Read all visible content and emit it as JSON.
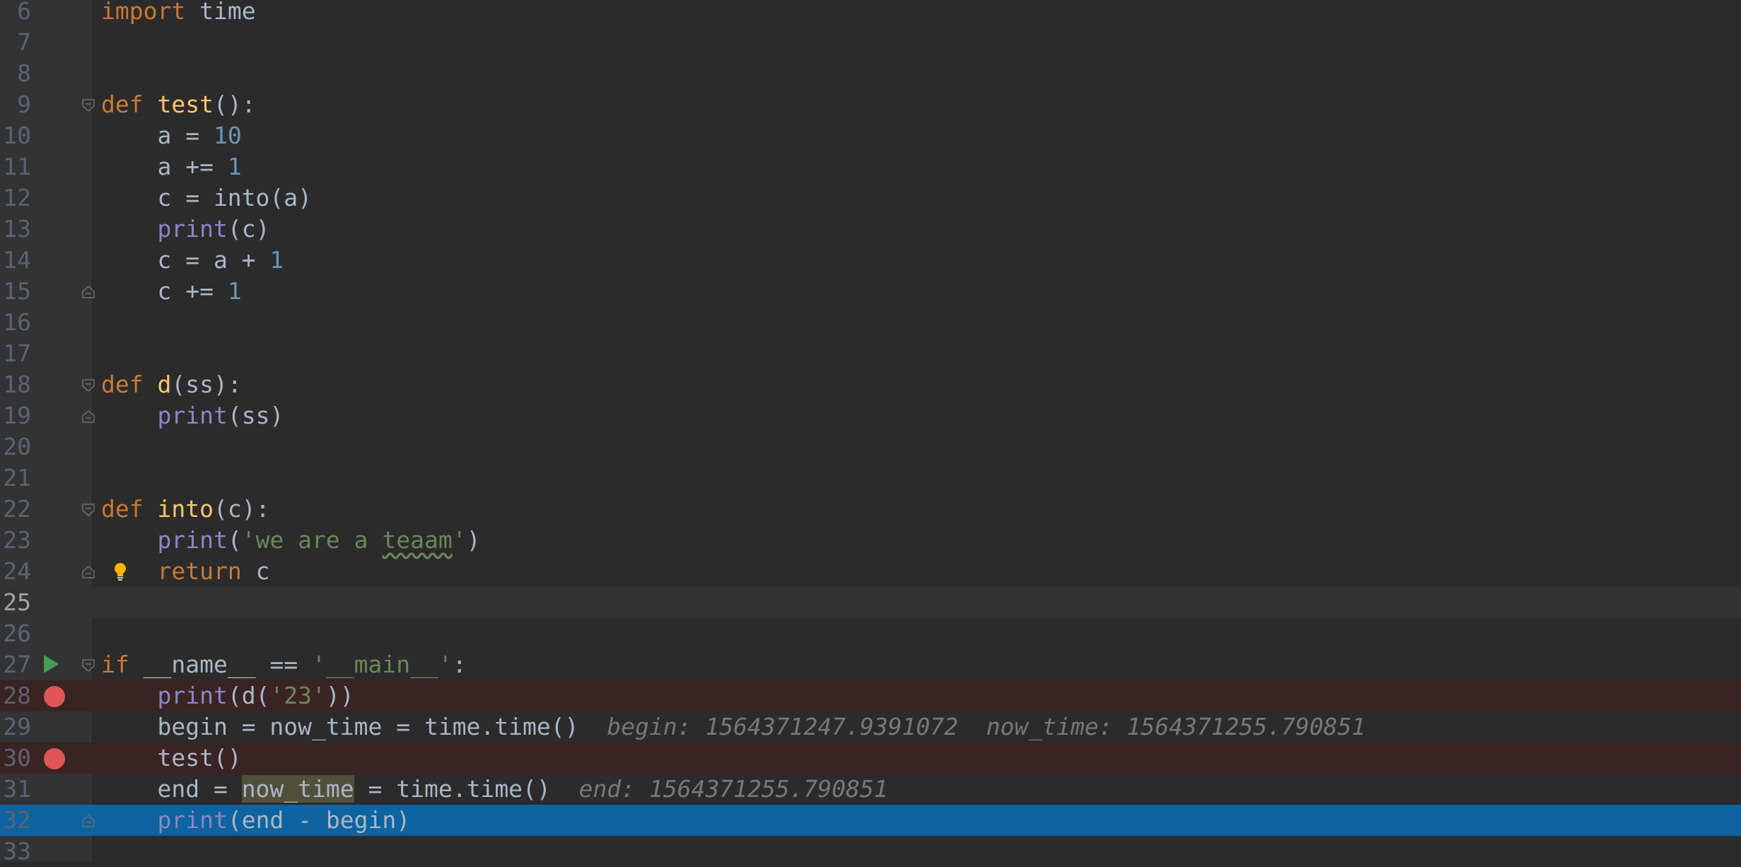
{
  "editor": {
    "language": "python",
    "current_line": 25,
    "lines": [
      {
        "n": "6",
        "tokens": [
          {
            "t": "import",
            "c": "kw"
          },
          {
            "t": " time",
            "c": "plain"
          }
        ]
      },
      {
        "n": "7",
        "tokens": []
      },
      {
        "n": "8",
        "tokens": []
      },
      {
        "n": "9",
        "fold": "start",
        "tokens": [
          {
            "t": "def",
            "c": "kw"
          },
          {
            "t": " ",
            "c": "plain"
          },
          {
            "t": "test",
            "c": "fn"
          },
          {
            "t": "():",
            "c": "plain"
          }
        ]
      },
      {
        "n": "10",
        "tokens": [
          {
            "t": "    a = ",
            "c": "plain"
          },
          {
            "t": "10",
            "c": "num"
          }
        ]
      },
      {
        "n": "11",
        "tokens": [
          {
            "t": "    a += ",
            "c": "plain"
          },
          {
            "t": "1",
            "c": "num"
          }
        ]
      },
      {
        "n": "12",
        "tokens": [
          {
            "t": "    c = into(a)",
            "c": "plain"
          }
        ]
      },
      {
        "n": "13",
        "tokens": [
          {
            "t": "    ",
            "c": "plain"
          },
          {
            "t": "print",
            "c": "bi"
          },
          {
            "t": "(c)",
            "c": "plain"
          }
        ]
      },
      {
        "n": "14",
        "tokens": [
          {
            "t": "    c = a + ",
            "c": "plain"
          },
          {
            "t": "1",
            "c": "num"
          }
        ]
      },
      {
        "n": "15",
        "fold": "end",
        "tokens": [
          {
            "t": "    c += ",
            "c": "plain"
          },
          {
            "t": "1",
            "c": "num"
          }
        ]
      },
      {
        "n": "16",
        "tokens": []
      },
      {
        "n": "17",
        "tokens": []
      },
      {
        "n": "18",
        "fold": "start",
        "tokens": [
          {
            "t": "def",
            "c": "kw"
          },
          {
            "t": " ",
            "c": "plain"
          },
          {
            "t": "d",
            "c": "fn"
          },
          {
            "t": "(ss):",
            "c": "plain"
          }
        ]
      },
      {
        "n": "19",
        "fold": "end",
        "tokens": [
          {
            "t": "    ",
            "c": "plain"
          },
          {
            "t": "print",
            "c": "bi"
          },
          {
            "t": "(ss)",
            "c": "plain"
          }
        ]
      },
      {
        "n": "20",
        "tokens": []
      },
      {
        "n": "21",
        "tokens": []
      },
      {
        "n": "22",
        "fold": "start",
        "tokens": [
          {
            "t": "def",
            "c": "kw"
          },
          {
            "t": " ",
            "c": "plain"
          },
          {
            "t": "into",
            "c": "fn"
          },
          {
            "t": "(c):",
            "c": "plain"
          }
        ]
      },
      {
        "n": "23",
        "tokens": [
          {
            "t": "    ",
            "c": "plain"
          },
          {
            "t": "print",
            "c": "bi"
          },
          {
            "t": "(",
            "c": "plain"
          },
          {
            "t": "'we are a ",
            "c": "str"
          },
          {
            "t": "teaam",
            "c": "str typo"
          },
          {
            "t": "'",
            "c": "str"
          },
          {
            "t": ")",
            "c": "plain"
          }
        ]
      },
      {
        "n": "24",
        "fold": "end",
        "bulb": true,
        "tokens": [
          {
            "t": "    ",
            "c": "plain"
          },
          {
            "t": "return",
            "c": "kw"
          },
          {
            "t": " c",
            "c": "plain"
          }
        ]
      },
      {
        "n": "25",
        "current": true,
        "tokens": []
      },
      {
        "n": "26",
        "tokens": []
      },
      {
        "n": "27",
        "fold": "start",
        "run": true,
        "tokens": [
          {
            "t": "if",
            "c": "kw"
          },
          {
            "t": " __name__ == ",
            "c": "plain"
          },
          {
            "t": "'__main__'",
            "c": "str"
          },
          {
            "t": ":",
            "c": "plain"
          }
        ]
      },
      {
        "n": "28",
        "breakpoint": true,
        "tokens": [
          {
            "t": "    ",
            "c": "plain"
          },
          {
            "t": "print",
            "c": "bi"
          },
          {
            "t": "(d(",
            "c": "plain"
          },
          {
            "t": "'23'",
            "c": "str"
          },
          {
            "t": "))",
            "c": "plain"
          }
        ]
      },
      {
        "n": "29",
        "tokens": [
          {
            "t": "    begin = now_time = time.time()",
            "c": "plain"
          },
          {
            "t": "  begin: 1564371247.9391072  now_time: 1564371255.790851",
            "c": "inline-val"
          }
        ]
      },
      {
        "n": "30",
        "breakpoint": true,
        "tokens": [
          {
            "t": "    test()",
            "c": "plain"
          }
        ]
      },
      {
        "n": "31",
        "tokens": [
          {
            "t": "    end = ",
            "c": "plain"
          },
          {
            "t": "now_time",
            "c": "plain hl-occ"
          },
          {
            "t": " = time.time()",
            "c": "plain"
          },
          {
            "t": "  end: 1564371255.790851",
            "c": "inline-val"
          }
        ]
      },
      {
        "n": "32",
        "fold": "end",
        "exec": true,
        "tokens": [
          {
            "t": "    ",
            "c": "plain"
          },
          {
            "t": "print",
            "c": "bi"
          },
          {
            "t": "(end - begin)",
            "c": "plain"
          }
        ]
      },
      {
        "n": "33",
        "tokens": []
      }
    ]
  },
  "colors": {
    "background": "#2b2b2b",
    "gutter": "#313335",
    "keyword": "#cc7832",
    "function": "#ffc66d",
    "builtin": "#8888c6",
    "number": "#6897bb",
    "string": "#6a8759",
    "text": "#a9b7c6",
    "breakpoint": "#e05555",
    "breakpoint_line": "#3a2323",
    "execution_line": "#0e63a0",
    "run_marker": "#499c54"
  },
  "icons": {
    "breakpoint": "breakpoint-icon",
    "run": "run-icon",
    "fold_start": "fold-start-icon",
    "fold_end": "fold-end-icon",
    "intention": "lightbulb-icon"
  }
}
